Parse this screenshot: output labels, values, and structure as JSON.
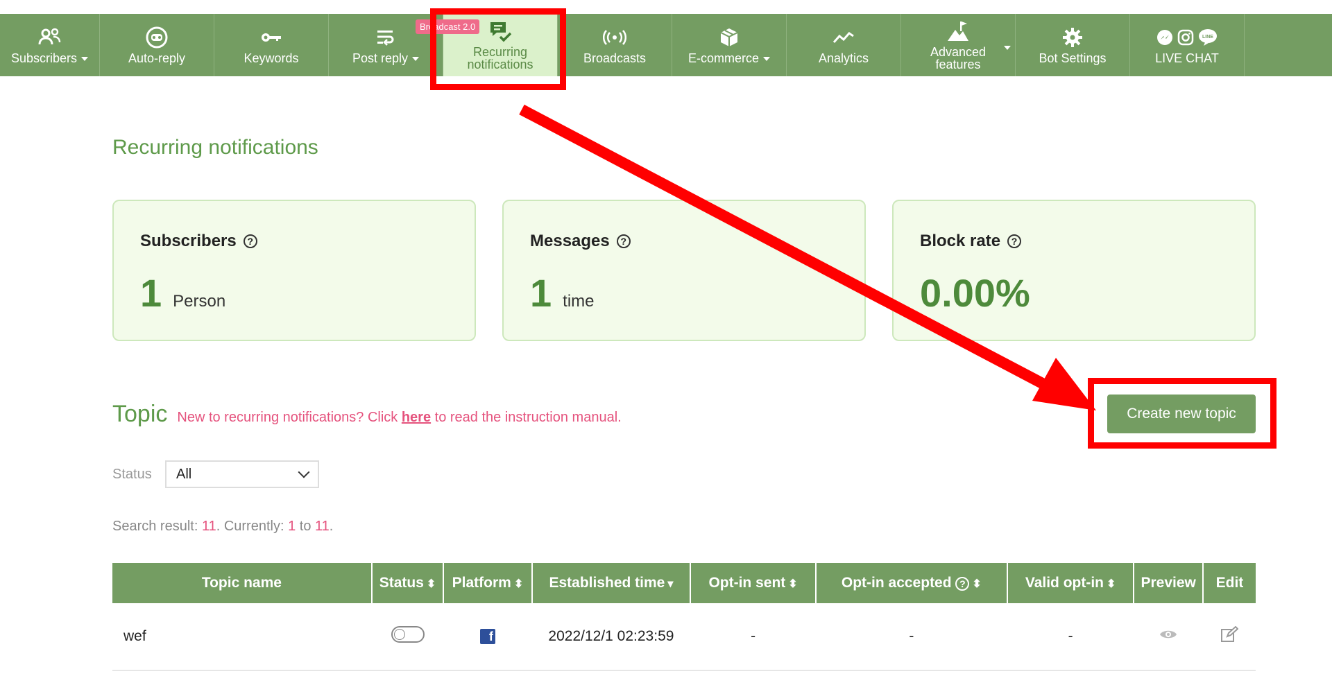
{
  "nav": {
    "items": [
      {
        "label": "Subscribers",
        "icon": "subscribers-icon",
        "dropdown": true
      },
      {
        "label": "Auto-reply",
        "icon": "bot-icon"
      },
      {
        "label": "Keywords",
        "icon": "key-icon"
      },
      {
        "label": "Post reply",
        "icon": "post-reply-icon",
        "dropdown": true
      },
      {
        "label": "Recurring notifications",
        "icon": "chat-check-icon",
        "badge": "Broadcast 2.0",
        "active": true
      },
      {
        "label": "Broadcasts",
        "icon": "broadcast-icon"
      },
      {
        "label": "E-commerce",
        "icon": "box-icon",
        "dropdown": true
      },
      {
        "label": "Analytics",
        "icon": "analytics-icon"
      },
      {
        "label": "Advanced features",
        "icon": "mountain-flag-icon",
        "dropdown": true
      },
      {
        "label": "Bot Settings",
        "icon": "gear-icon"
      },
      {
        "label": "LIVE CHAT",
        "icon": "live-chat-icons"
      }
    ]
  },
  "page": {
    "title": "Recurring notifications"
  },
  "stats": [
    {
      "label": "Subscribers",
      "value": "1",
      "unit": "Person"
    },
    {
      "label": "Messages",
      "value": "1",
      "unit": "time"
    },
    {
      "label": "Block rate",
      "value": "0.00%",
      "unit": ""
    }
  ],
  "topic": {
    "title": "Topic",
    "note_before": "New to recurring notifications? Click",
    "note_link": "here",
    "note_after": "to read the instruction manual.",
    "create_button": "Create new topic"
  },
  "filter": {
    "label": "Status",
    "selected": "All"
  },
  "search": {
    "prefix": "Search result: ",
    "total": "11",
    "mid": ". Currently: ",
    "from": "1",
    "to_word": " to ",
    "to": "11",
    "end": "."
  },
  "table": {
    "headers": [
      "Topic name",
      "Status",
      "Platform",
      "Established time",
      "Opt-in sent",
      "Opt-in accepted",
      "Valid opt-in",
      "Preview",
      "Edit"
    ],
    "rows": [
      {
        "name": "wef",
        "status": "off",
        "platform": "facebook",
        "established": "2022/12/1 02:23:59",
        "optin_sent": "-",
        "optin_accepted": "-",
        "valid_optin": "-"
      }
    ]
  },
  "colors": {
    "brand_green": "#749d62",
    "active_tab": "#dbf1cb",
    "pink": "#e5527d",
    "highlight_red": "#ff0000"
  }
}
